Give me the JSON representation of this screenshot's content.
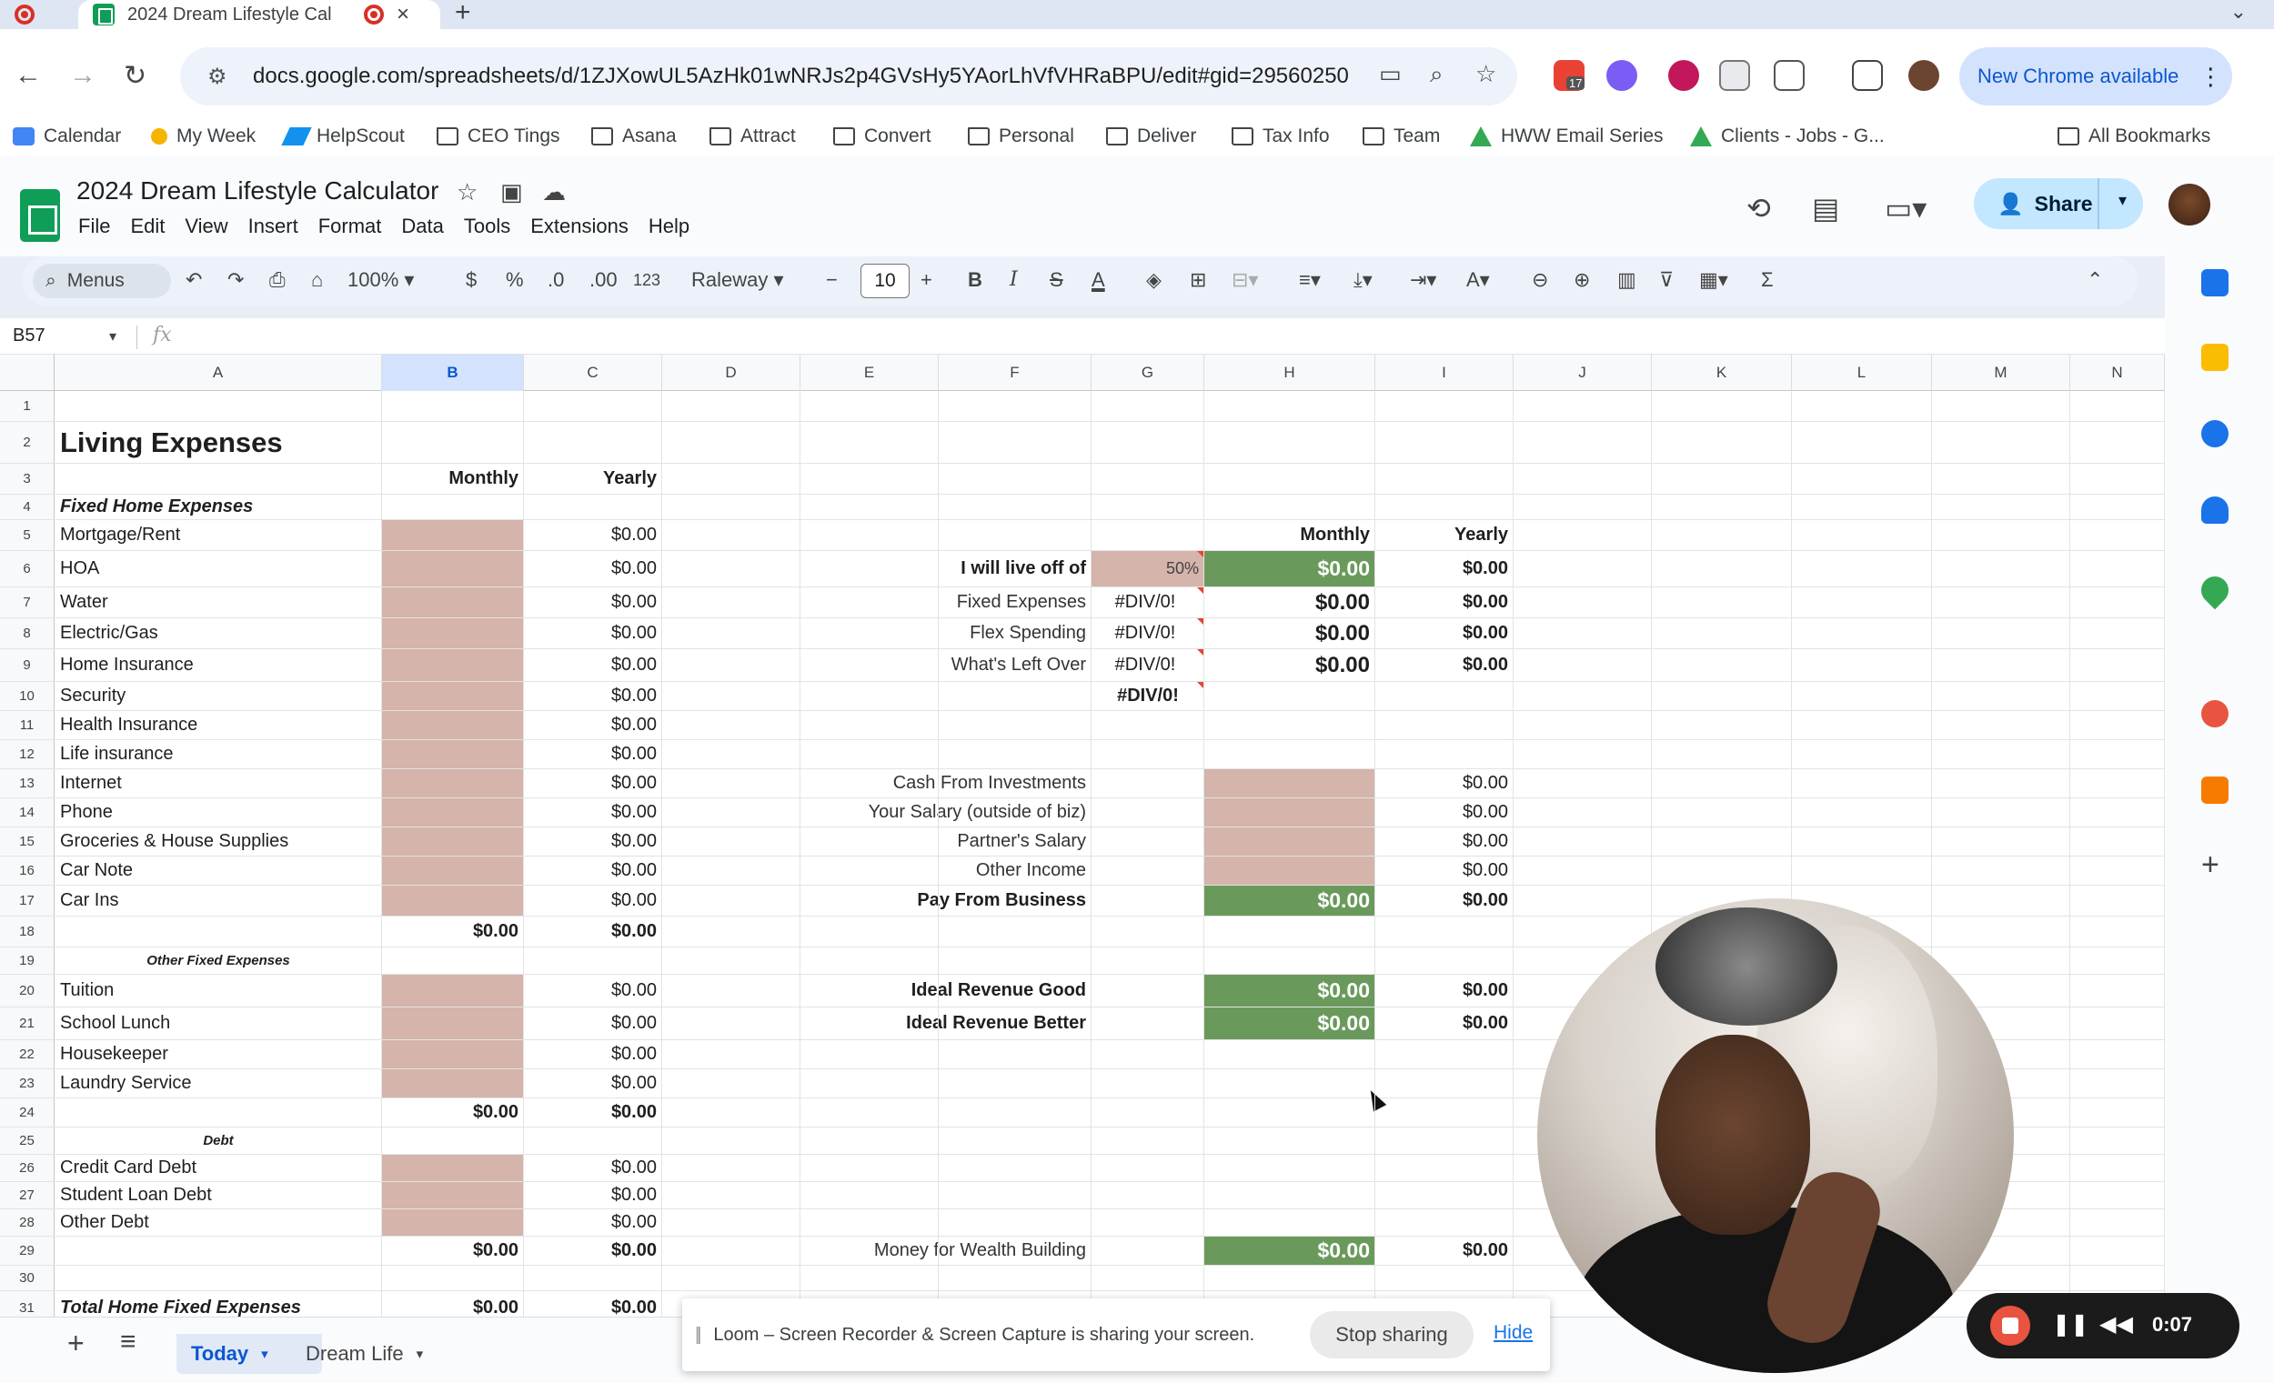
{
  "browser": {
    "tab_title": "2024 Dream Lifestyle Cal",
    "url": "docs.google.com/spreadsheets/d/1ZJXowUL5AzHk01wNRJs2p4GVsHy5YAorLhVfVHRaBPU/edit#gid=29560250",
    "new_chrome_label": "New Chrome available",
    "extension_badge": "17",
    "bookmarks": [
      "Calendar",
      "My Week",
      "HelpScout",
      "CEO Tings",
      "Asana",
      "Attract",
      "Convert",
      "Personal",
      "Deliver",
      "Tax Info",
      "Team",
      "HWW Email Series",
      "Clients - Jobs - G...",
      "All Bookmarks"
    ]
  },
  "sheets": {
    "doc_title": "2024 Dream Lifestyle Calculator",
    "menu": [
      "File",
      "Edit",
      "View",
      "Insert",
      "Format",
      "Data",
      "Tools",
      "Extensions",
      "Help"
    ],
    "share_label": "Share",
    "toolbar": {
      "menus_label": "Menus",
      "zoom": "100%",
      "currency": "$",
      "percent": "%",
      "dec_decrease": ".0",
      "dec_increase": ".00",
      "number_format": "123",
      "font": "Raleway",
      "font_size": "10"
    },
    "name_box": "B57",
    "fx_label": "fx",
    "selected_column": "B",
    "columns": [
      "A",
      "B",
      "C",
      "D",
      "E",
      "F",
      "G",
      "H",
      "I",
      "J",
      "K",
      "L",
      "M",
      "N"
    ],
    "rows": {
      "r1": {
        "num": "1"
      },
      "r2": {
        "num": "2",
        "a": "Living Expenses"
      },
      "r3": {
        "num": "3",
        "b": "Monthly",
        "c": "Yearly"
      },
      "r4": {
        "num": "4",
        "a": "Fixed Home Expenses"
      },
      "r5": {
        "num": "5",
        "a": "Mortgage/Rent",
        "c": "$0.00",
        "h": "Monthly",
        "i": "Yearly"
      },
      "r6": {
        "num": "6",
        "a": "HOA",
        "c": "$0.00",
        "f": "I will live off of",
        "g": "50%",
        "h": "$0.00",
        "i": "$0.00"
      },
      "r7": {
        "num": "7",
        "a": "Water",
        "c": "$0.00",
        "f": "Fixed Expenses",
        "g": "#DIV/0!",
        "h": "$0.00",
        "i": "$0.00"
      },
      "r8": {
        "num": "8",
        "a": "Electric/Gas",
        "c": "$0.00",
        "f": "Flex Spending",
        "g": "#DIV/0!",
        "h": "$0.00",
        "i": "$0.00"
      },
      "r9": {
        "num": "9",
        "a": "Home Insurance",
        "c": "$0.00",
        "f": "What's Left Over",
        "g": "#DIV/0!",
        "h": "$0.00",
        "i": "$0.00"
      },
      "r10": {
        "num": "10",
        "a": "Security",
        "c": "$0.00",
        "g": "#DIV/0!"
      },
      "r11": {
        "num": "11",
        "a": "Health Insurance",
        "c": "$0.00"
      },
      "r12": {
        "num": "12",
        "a": "Life insurance",
        "c": "$0.00"
      },
      "r13": {
        "num": "13",
        "a": "Internet",
        "c": "$0.00",
        "f": "Cash From Investments",
        "i": "$0.00"
      },
      "r14": {
        "num": "14",
        "a": "Phone",
        "c": "$0.00",
        "f": "Your Salary (outside of biz)",
        "i": "$0.00"
      },
      "r15": {
        "num": "15",
        "a": "Groceries & House Supplies",
        "c": "$0.00",
        "f": "Partner's Salary",
        "i": "$0.00"
      },
      "r16": {
        "num": "16",
        "a": "Car Note",
        "c": "$0.00",
        "f": "Other Income",
        "i": "$0.00"
      },
      "r17": {
        "num": "17",
        "a": "Car Ins",
        "c": "$0.00",
        "f": "Pay From Business",
        "h": "$0.00",
        "i": "$0.00"
      },
      "r18": {
        "num": "18",
        "b": "$0.00",
        "c": "$0.00"
      },
      "r19": {
        "num": "19",
        "a": "Other Fixed Expenses"
      },
      "r20": {
        "num": "20",
        "a": "Tuition",
        "c": "$0.00",
        "f": "Ideal Revenue Good",
        "h": "$0.00",
        "i": "$0.00"
      },
      "r21": {
        "num": "21",
        "a": "School Lunch",
        "c": "$0.00",
        "f": "Ideal Revenue Better",
        "h": "$0.00",
        "i": "$0.00"
      },
      "r22": {
        "num": "22",
        "a": "Housekeeper",
        "c": "$0.00"
      },
      "r23": {
        "num": "23",
        "a": "Laundry Service",
        "c": "$0.00"
      },
      "r24": {
        "num": "24",
        "b": "$0.00",
        "c": "$0.00"
      },
      "r25": {
        "num": "25",
        "a": "Debt"
      },
      "r26": {
        "num": "26",
        "a": "Credit Card Debt",
        "c": "$0.00"
      },
      "r27": {
        "num": "27",
        "a": "Student Loan Debt",
        "c": "$0.00"
      },
      "r28": {
        "num": "28",
        "a": "Other Debt",
        "c": "$0.00"
      },
      "r29": {
        "num": "29",
        "b": "$0.00",
        "c": "$0.00",
        "f": "Money for Wealth Building",
        "h": "$0.00",
        "i": "$0.00"
      },
      "r30": {
        "num": "30"
      },
      "r31": {
        "num": "31",
        "a": "Total Home Fixed Expenses",
        "b": "$0.00",
        "c": "$0.00"
      }
    },
    "sheet_tabs": [
      "Today",
      "Dream Life"
    ]
  },
  "loom": {
    "message": "Loom – Screen Recorder & Screen Capture is sharing your screen.",
    "stop_label": "Stop sharing",
    "hide_label": "Hide",
    "timer": "0:07"
  },
  "colors": {
    "input_cell": "#d5b4ab",
    "result_cell": "#6a9a5b",
    "accent": "#0b57d0"
  }
}
